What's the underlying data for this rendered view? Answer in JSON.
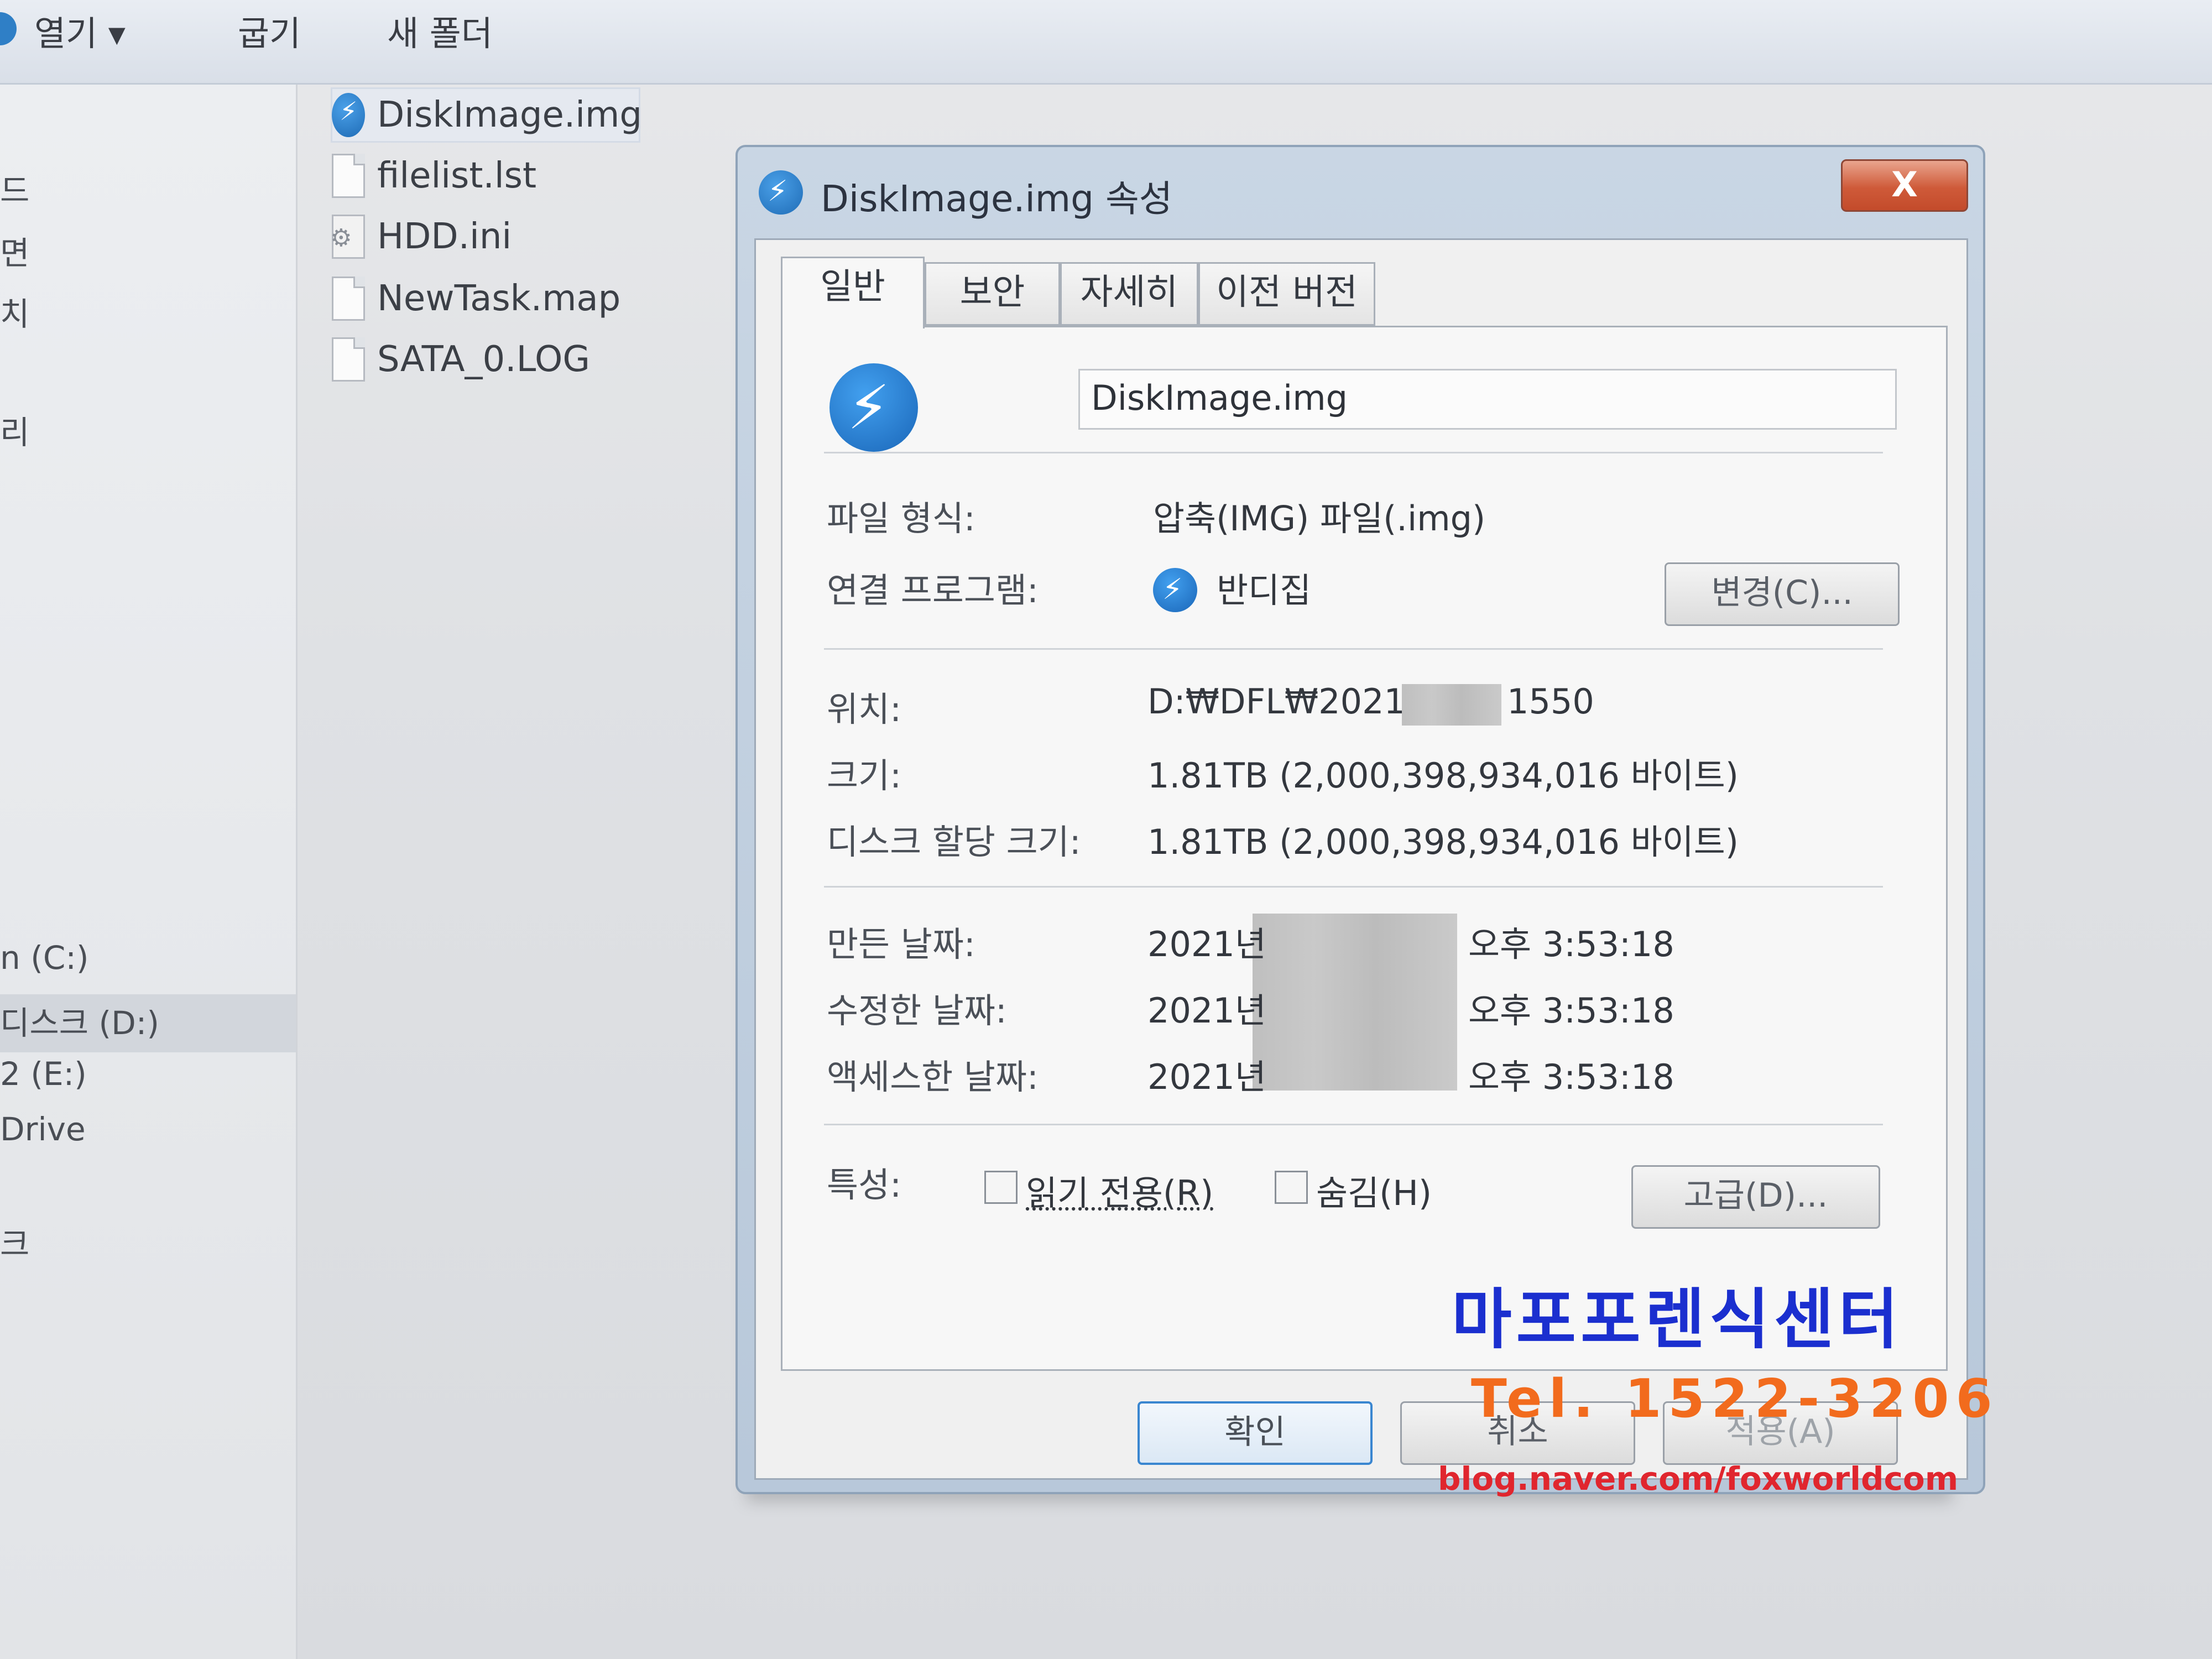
{
  "toolbar": {
    "open_label": "열기 ▾",
    "burn_label": "굽기",
    "new_folder_label": "새 폴더"
  },
  "nav": {
    "items": [
      "드",
      "면",
      "치",
      "리",
      "n (C:)",
      "디스크 (D:)",
      "2 (E:)",
      "Drive",
      "크"
    ]
  },
  "files": [
    {
      "name": "DiskImage.img",
      "icon": "bandizip-icon"
    },
    {
      "name": "filelist.lst",
      "icon": "document-icon"
    },
    {
      "name": "HDD.ini",
      "icon": "settings-file-icon"
    },
    {
      "name": "NewTask.map",
      "icon": "document-icon"
    },
    {
      "name": "SATA_0.LOG",
      "icon": "document-icon"
    }
  ],
  "dialog": {
    "title": "DiskImage.img 속성",
    "close_label": "X",
    "tabs": [
      "일반",
      "보안",
      "자세히",
      "이전 버전"
    ],
    "filename": "DiskImage.img",
    "file_type_label": "파일 형식:",
    "file_type_value": "압축(IMG) 파일(.img)",
    "opens_with_label": "연결 프로그램:",
    "opens_with_value": "반디집",
    "change_button": "변경(C)...",
    "location_label": "위치:",
    "location_prefix": "D:₩DFL₩2021-",
    "location_suffix": "1550",
    "size_label": "크기:",
    "size_value": "1.81TB (2,000,398,934,016 바이트)",
    "size_on_disk_label": "디스크 할당 크기:",
    "size_on_disk_value": "1.81TB (2,000,398,934,016 바이트)",
    "created_label": "만든 날짜:",
    "created_year": "2021년",
    "created_time": "오후 3:53:18",
    "modified_label": "수정한 날짜:",
    "modified_year": "2021년",
    "modified_time": "오후 3:53:18",
    "accessed_label": "액세스한 날짜:",
    "accessed_year": "2021년",
    "accessed_time": "오후 3:53:18",
    "attributes_label": "특성:",
    "readonly_label": "읽기 전용(R)",
    "hidden_label": "숨김(H)",
    "advanced_button": "고급(D)...",
    "ok_button": "확인",
    "cancel_button": "취소",
    "apply_button": "적용(A)"
  },
  "watermark": {
    "center_name": "마포포렌식센터",
    "tel": "Tel. 1522-3206",
    "blog": "blog.naver.com/foxworldcom"
  }
}
